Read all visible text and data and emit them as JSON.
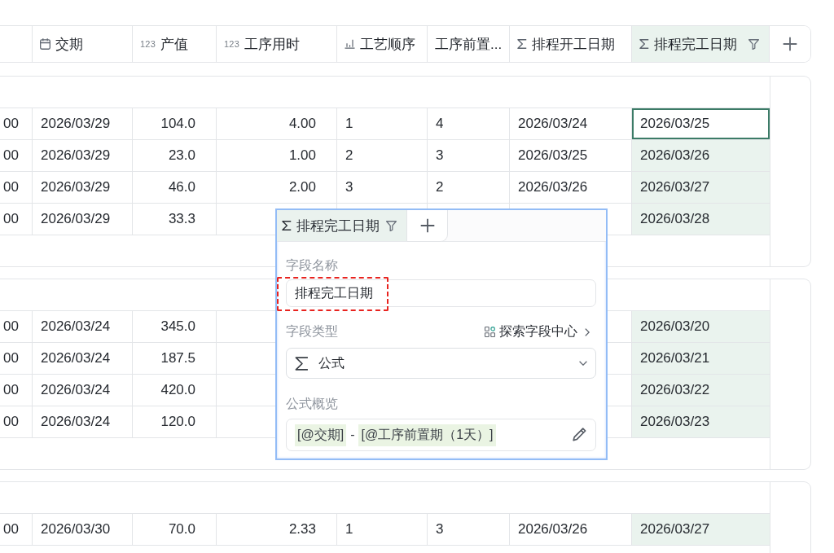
{
  "table": {
    "columns": [
      {
        "kind": "number",
        "selected": false,
        "filtered": false
      },
      {
        "label": "交期",
        "kind": "date",
        "selected": false,
        "filtered": false
      },
      {
        "label": "产值",
        "kind": "number",
        "type_label": "123",
        "selected": false,
        "filtered": false
      },
      {
        "label": "工序用时",
        "kind": "number",
        "type_label": "123",
        "selected": false,
        "filtered": false
      },
      {
        "label": "工艺顺序",
        "kind": "rank",
        "selected": false,
        "filtered": false
      },
      {
        "label": "工序前置...",
        "kind": "text",
        "selected": false,
        "filtered": false
      },
      {
        "label": "排程开工日期",
        "kind": "formula",
        "selected": false,
        "filtered": false
      },
      {
        "label": "排程完工日期",
        "kind": "formula",
        "selected": true,
        "filtered": true
      }
    ],
    "groups": [
      {
        "rows": [
          {
            "focused": true,
            "cells": [
              "00",
              "2026/03/29",
              "104.0",
              "4.00",
              "1",
              "4",
              "2026/03/24",
              "2026/03/25"
            ]
          },
          {
            "focused": false,
            "cells": [
              "00",
              "2026/03/29",
              "23.0",
              "1.00",
              "2",
              "3",
              "2026/03/25",
              "2026/03/26"
            ]
          },
          {
            "focused": false,
            "cells": [
              "00",
              "2026/03/29",
              "46.0",
              "2.00",
              "3",
              "2",
              "2026/03/26",
              "2026/03/27"
            ]
          },
          {
            "focused": false,
            "cells": [
              "00",
              "2026/03/29",
              "33.3",
              null,
              null,
              null,
              null,
              "2026/03/28"
            ]
          }
        ]
      },
      {
        "rows": [
          {
            "focused": false,
            "cells": [
              "00",
              "2026/03/24",
              "345.0",
              null,
              null,
              null,
              null,
              "2026/03/20"
            ]
          },
          {
            "focused": false,
            "cells": [
              "00",
              "2026/03/24",
              "187.5",
              null,
              null,
              null,
              null,
              "2026/03/21"
            ]
          },
          {
            "focused": false,
            "cells": [
              "00",
              "2026/03/24",
              "420.0",
              null,
              null,
              null,
              null,
              "2026/03/22"
            ]
          },
          {
            "focused": false,
            "cells": [
              "00",
              "2026/03/24",
              "120.0",
              null,
              null,
              null,
              null,
              "2026/03/23"
            ]
          }
        ]
      },
      {
        "rows": [
          {
            "focused": false,
            "cells": [
              "00",
              "2026/03/30",
              "70.0",
              "2.33",
              "1",
              "3",
              "2026/03/26",
              "2026/03/27"
            ]
          }
        ]
      }
    ]
  },
  "field_popup": {
    "header_tab": {
      "label": "排程完工日期",
      "kind": "formula",
      "selected": true,
      "filtered": true
    },
    "name_field": {
      "label": "字段名称",
      "value": "排程完工日期",
      "highlighted": true
    },
    "type_field": {
      "label": "字段类型",
      "link": "探索字段中心",
      "kind": "formula",
      "value": "公式"
    },
    "formula_preview": {
      "label": "公式概览",
      "tokens": [
        {
          "kind": "field",
          "text": "[@交期]"
        },
        {
          "kind": "operator",
          "text": "-"
        },
        {
          "kind": "field",
          "text": "[@工序前置期（1天）]"
        }
      ]
    }
  }
}
